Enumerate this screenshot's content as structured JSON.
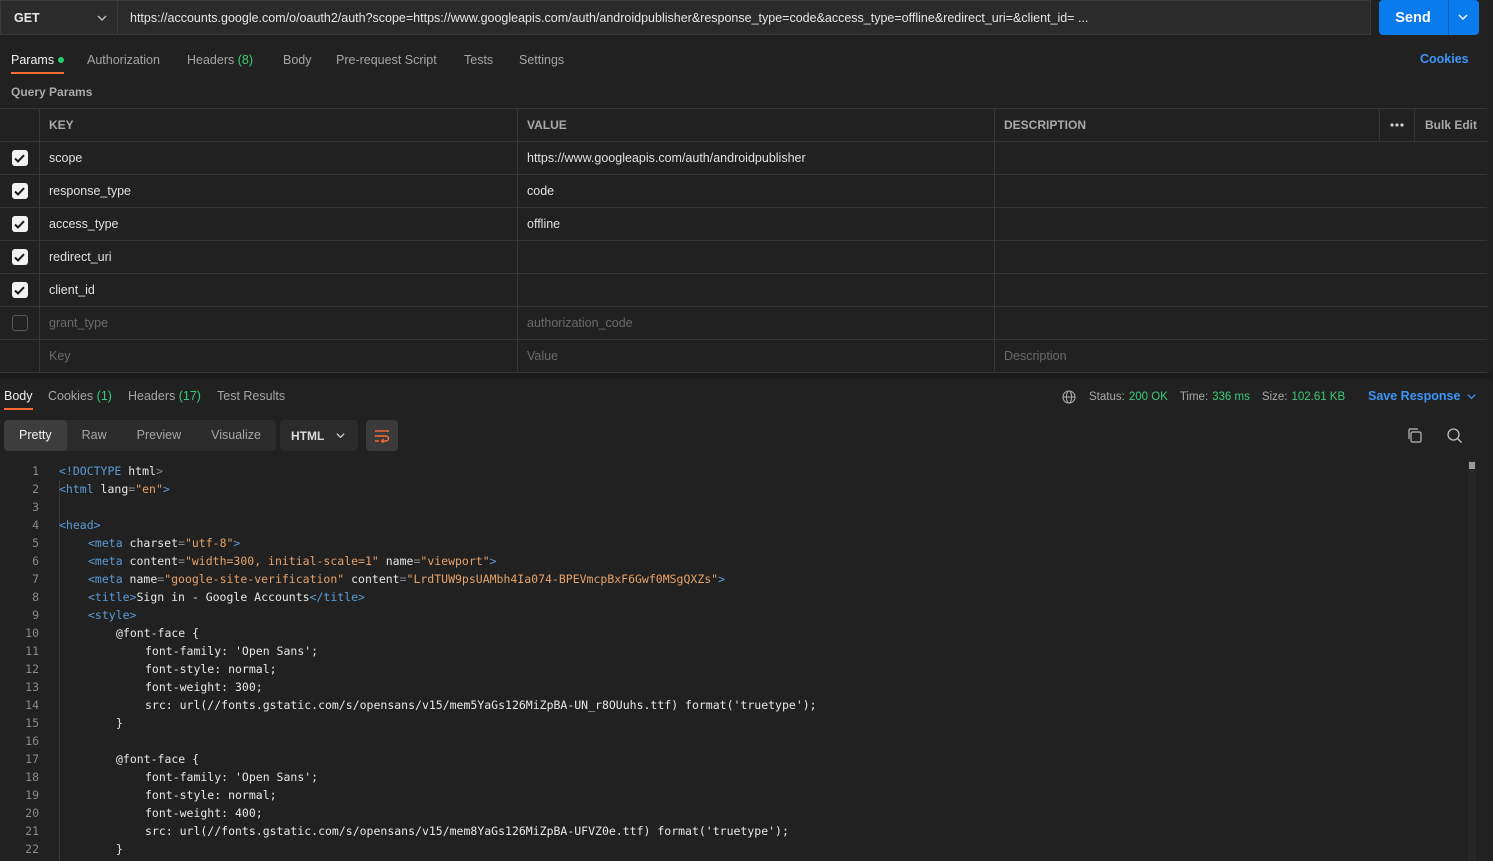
{
  "request": {
    "method": "GET",
    "url": "https://accounts.google.com/o/oauth2/auth?scope=https://www.googleapis.com/auth/androidpublisher&response_type=code&access_type=offline&redirect_uri=&client_id= ...",
    "send_label": "Send"
  },
  "request_tabs": {
    "params": "Params",
    "authorization": "Authorization",
    "headers": "Headers",
    "headers_count": "(8)",
    "body": "Body",
    "prerequest": "Pre-request Script",
    "tests": "Tests",
    "settings": "Settings",
    "cookies": "Cookies"
  },
  "query_params": {
    "title": "Query Params",
    "columns": {
      "key": "KEY",
      "value": "VALUE",
      "description": "DESCRIPTION",
      "bulk_edit": "Bulk Edit"
    },
    "rows": [
      {
        "key": "scope",
        "value": "https://www.googleapis.com/auth/androidpublisher",
        "enabled": true
      },
      {
        "key": "response_type",
        "value": "code",
        "enabled": true
      },
      {
        "key": "access_type",
        "value": "offline",
        "enabled": true
      },
      {
        "key": "redirect_uri",
        "value": "",
        "enabled": true
      },
      {
        "key": "client_id",
        "value": "",
        "enabled": true
      },
      {
        "key": "grant_type",
        "value": "authorization_code",
        "enabled": false
      }
    ],
    "placeholders": {
      "key": "Key",
      "value": "Value",
      "description": "Description"
    }
  },
  "response_tabs": {
    "body": "Body",
    "cookies": "Cookies",
    "cookies_count": "(1)",
    "headers": "Headers",
    "headers_count": "(17)",
    "test_results": "Test Results"
  },
  "response_status": {
    "status_label": "Status:",
    "status_value": "200 OK",
    "time_label": "Time:",
    "time_value": "336 ms",
    "size_label": "Size:",
    "size_value": "102.61 KB",
    "save_response": "Save Response"
  },
  "view_modes": {
    "pretty": "Pretty",
    "raw": "Raw",
    "preview": "Preview",
    "visualize": "Visualize",
    "format": "HTML"
  },
  "code": {
    "line_numbers": [
      "1",
      "2",
      "3",
      "4",
      "5",
      "6",
      "7",
      "8",
      "9",
      "10",
      "11",
      "12",
      "13",
      "14",
      "15",
      "16",
      "17",
      "18",
      "19",
      "20",
      "21",
      "22"
    ],
    "l1": [
      "<!DOCTYPE ",
      "html",
      ">"
    ],
    "l2": [
      "<html ",
      "lang",
      "=",
      "\"en\"",
      ">"
    ],
    "l4": "<head>",
    "l5": [
      "<meta ",
      "charset",
      "=",
      "\"utf-8\"",
      ">"
    ],
    "l6": [
      "<meta ",
      "content",
      "=",
      "\"width=300, initial-scale=1\"",
      " name",
      "=",
      "\"viewport\"",
      ">"
    ],
    "l7": [
      "<meta ",
      "name",
      "=",
      "\"google-site-verification\"",
      " content",
      "=",
      "\"LrdTUW9psUAMbh4Ia074-BPEVmcpBxF6Gwf0MSgQXZs\"",
      ">"
    ],
    "l8": [
      "<title>",
      "Sign in - Google Accounts",
      "</title>"
    ],
    "l9": "<style>",
    "l10": "@font-face {",
    "l11": "font-family: 'Open Sans';",
    "l12": "font-style: normal;",
    "l13": "font-weight: 300;",
    "l14": "src: url(//fonts.gstatic.com/s/opensans/v15/mem5YaGs126MiZpBA-UN_r8OUuhs.ttf) format('truetype');",
    "l15": "}",
    "l17": "@font-face {",
    "l18": "font-family: 'Open Sans';",
    "l19": "font-style: normal;",
    "l20": "font-weight: 400;",
    "l21": "src: url(//fonts.gstatic.com/s/opensans/v15/mem8YaGs126MiZpBA-UFVZ0e.ttf) format('truetype');",
    "l22": "}"
  },
  "colors": {
    "accent": "#097bed",
    "active_tab": "#ff6c37",
    "success": "#3ccb77",
    "link": "#3d95f5"
  }
}
